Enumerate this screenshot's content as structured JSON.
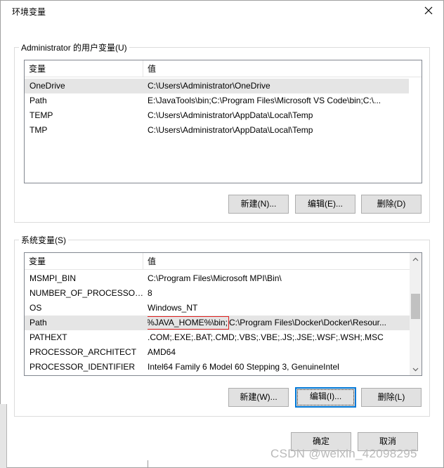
{
  "window": {
    "title": "环境变量"
  },
  "user_vars": {
    "group_label": "Administrator 的用户变量(U)",
    "headers": {
      "variable": "变量",
      "value": "值"
    },
    "rows": [
      {
        "name": "OneDrive",
        "value": "C:\\Users\\Administrator\\OneDrive"
      },
      {
        "name": "Path",
        "value": "E:\\JavaTools\\bin;C:\\Program Files\\Microsoft VS Code\\bin;C:\\..."
      },
      {
        "name": "TEMP",
        "value": "C:\\Users\\Administrator\\AppData\\Local\\Temp"
      },
      {
        "name": "TMP",
        "value": "C:\\Users\\Administrator\\AppData\\Local\\Temp"
      }
    ],
    "buttons": {
      "new": "新建(N)...",
      "edit": "编辑(E)...",
      "delete": "删除(D)"
    }
  },
  "system_vars": {
    "group_label": "系统变量(S)",
    "headers": {
      "variable": "变量",
      "value": "值"
    },
    "rows": [
      {
        "name": "MSMPI_BIN",
        "value": "C:\\Program Files\\Microsoft MPI\\Bin\\"
      },
      {
        "name": "NUMBER_OF_PROCESSORS",
        "value": "8"
      },
      {
        "name": "OS",
        "value": "Windows_NT"
      },
      {
        "name": "Path",
        "value_highlight": "%JAVA_HOME%\\bin;",
        "value_rest": "C:\\Program Files\\Docker\\Docker\\Resour..."
      },
      {
        "name": "PATHEXT",
        "value": ".COM;.EXE;.BAT;.CMD;.VBS;.VBE;.JS;.JSE;.WSF;.WSH;.MSC"
      },
      {
        "name": "PROCESSOR_ARCHITECT",
        "value": "AMD64"
      },
      {
        "name": "PROCESSOR_IDENTIFIER",
        "value": "Intel64 Family 6 Model 60 Stepping 3, GenuineIntel"
      }
    ],
    "buttons": {
      "new": "新建(W)...",
      "edit": "编辑(I)...",
      "delete": "删除(L)"
    }
  },
  "footer": {
    "ok": "确定",
    "cancel": "取消"
  },
  "watermark": "CSDN @weixin_42098295",
  "colors": {
    "selection": "#e5e5e5",
    "highlight_box": "#e0201f",
    "default_button": "#0078d7"
  }
}
